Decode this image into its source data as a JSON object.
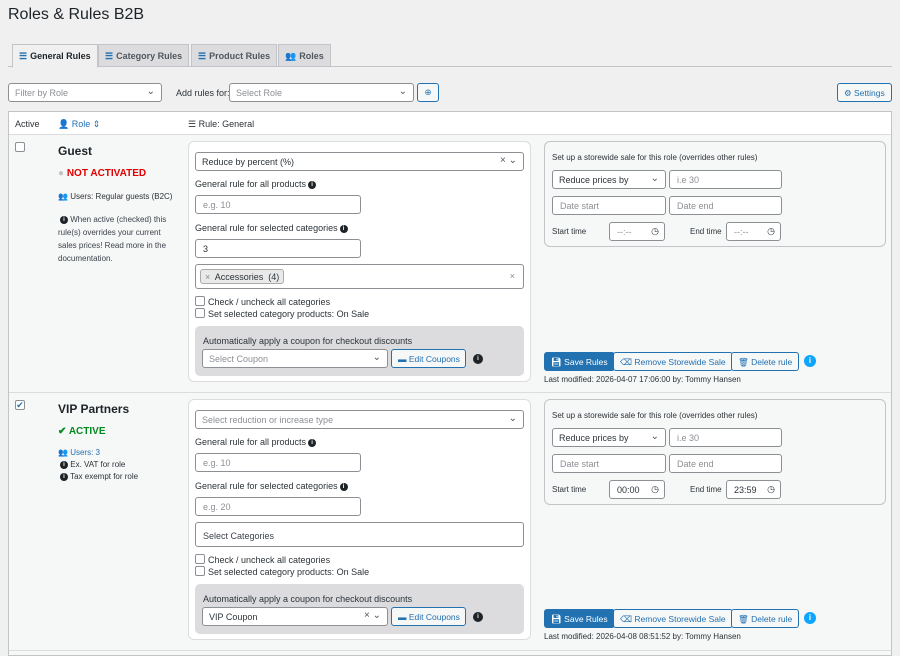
{
  "title": "Roles & Rules B2B",
  "tabs": [
    {
      "label": "General Rules"
    },
    {
      "label": "Category Rules"
    },
    {
      "label": "Product Rules"
    },
    {
      "label": "Roles"
    }
  ],
  "toolbar": {
    "filter_placeholder": "Filter by Role",
    "add_rules_label": "Add rules for:",
    "select_role_placeholder": "Select Role",
    "settings_label": "Settings"
  },
  "header": {
    "active": "Active",
    "role": "Role",
    "rule": "Rule: General"
  },
  "common": {
    "all_products_label": "General rule for all products",
    "cat_label": "General rule for selected categories",
    "check_all": "Check / uncheck all categories",
    "on_sale": "Set selected category products: On Sale",
    "coupon_label": "Automatically apply a coupon for checkout discounts",
    "edit_coupons": "Edit Coupons",
    "sale_title": "Set up a storewide sale for this role (overrides other rules)",
    "reduce_prices": "Reduce prices by",
    "sale_placeholder": "i.e 30",
    "date_start": "Date start",
    "date_end": "Date end",
    "start_time": "Start time",
    "end_time": "End time",
    "save": "Save Rules",
    "remove_sale": "Remove Storewide Sale",
    "delete": "Delete rule"
  },
  "roles": [
    {
      "name": "Guest",
      "checked": false,
      "status": "NOT ACTIVATED",
      "users": "Users: Regular guests (B2C)",
      "note": "When active (checked) this rule(s) overrides your current sales prices! Read more in the documentation.",
      "reduction": "Reduce by percent (%)",
      "all_products_placeholder": "e.g. 10",
      "cat_value": "3",
      "category_tag": "Accessories  (4)",
      "coupon": "Select Coupon",
      "start_time": "--:--",
      "end_time": "--:--",
      "last_modified": "Last modified: 2026-04-07 17:06:00 by: Tommy Hansen"
    },
    {
      "name": "VIP Partners",
      "checked": true,
      "status": "ACTIVE",
      "users": "Users: 3",
      "extra1": "Ex. VAT for role",
      "extra2": "Tax exempt for role",
      "reduction": "Select reduction or increase type",
      "all_products_placeholder": "e.g. 10",
      "cat_placeholder": "e.g. 20",
      "categories_placeholder": "Select Categories",
      "coupon": "VIP Coupon",
      "start_time": "00:00",
      "end_time": "23:59",
      "last_modified": "Last modified: 2026-04-08 08:51:52 by: Tommy Hansen"
    }
  ],
  "colors": {
    "accent": "#2271b1",
    "inactive": "#e00000",
    "active": "#008a20"
  }
}
